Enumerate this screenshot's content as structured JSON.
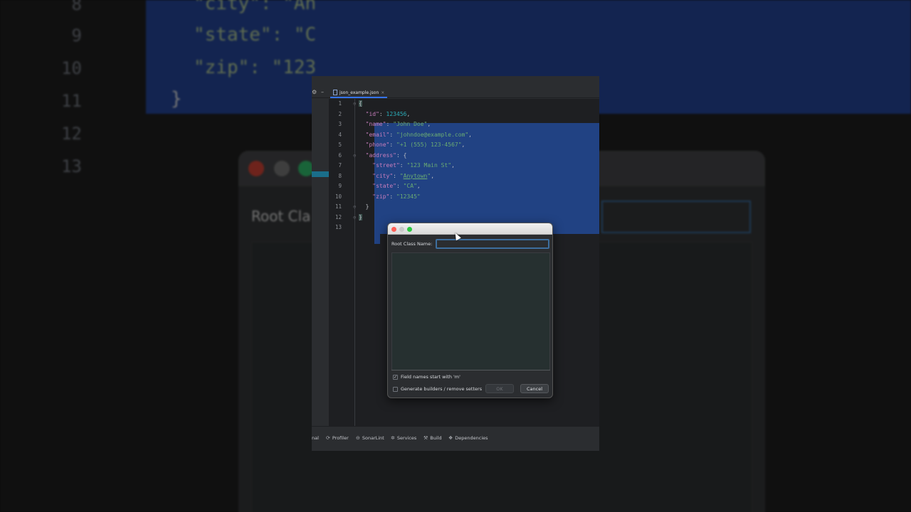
{
  "background": {
    "gutter_numbers": [
      "8",
      "9",
      "10",
      "11",
      "12",
      "13"
    ],
    "code_lines": [
      "\"city\": \"An",
      "\"state\": \"C",
      "\"zip\": \"123",
      "}"
    ],
    "dialog_title": "Root Cla"
  },
  "ide": {
    "tab": {
      "label": "json_example.json",
      "close": "×"
    },
    "toolbar_icons": {
      "settings": "⚙",
      "minimize": "–"
    },
    "lines": [
      {
        "n": "1"
      },
      {
        "n": "2"
      },
      {
        "n": "3"
      },
      {
        "n": "4"
      },
      {
        "n": "5"
      },
      {
        "n": "6"
      },
      {
        "n": "7"
      },
      {
        "n": "8"
      },
      {
        "n": "9"
      },
      {
        "n": "10"
      },
      {
        "n": "11"
      },
      {
        "n": "12"
      },
      {
        "n": "13"
      }
    ],
    "code": {
      "l1": "{",
      "id_key": "\"id\"",
      "id_val": "123456",
      "name_key": "\"name\"",
      "name_val": "\"John Doe\"",
      "email_key": "\"email\"",
      "email_val": "\"johndoe@example.com\"",
      "phone_key": "\"phone\"",
      "phone_val": "\"+1 (555) 123-4567\"",
      "address_key": "\"address\"",
      "street_key": "\"street\"",
      "street_val": "\"123 Main St\"",
      "city_key": "\"city\"",
      "city_q1": "\"",
      "city_val": "Anytown",
      "city_q2": "\"",
      "state_key": "\"state\"",
      "state_val": "\"CA\"",
      "zip_key": "\"zip\"",
      "zip_val": "\"12345\"",
      "close_inner": "}",
      "close_outer": "}"
    },
    "bottom_bar": [
      {
        "icon": "",
        "label": "nal"
      },
      {
        "icon": "⟳",
        "label": "Profiler"
      },
      {
        "icon": "⊖",
        "label": "SonarLint"
      },
      {
        "icon": "✲",
        "label": "Services"
      },
      {
        "icon": "⚒",
        "label": "Build"
      },
      {
        "icon": "❖",
        "label": "Dependencies"
      }
    ]
  },
  "dialog": {
    "root_class_label": "Root Class Name:",
    "root_class_value": "",
    "checkbox_m": {
      "label": "Field names start with 'm'",
      "checked": true,
      "mark": "✓"
    },
    "checkbox_builders": {
      "label": "Generate builders / remove setters",
      "checked": false,
      "mark": ""
    },
    "ok_label": "OK",
    "cancel_label": "Cancel"
  },
  "colors": {
    "selection": "#214283",
    "editor_bg": "#1e1f22",
    "key": "#c77dbb",
    "string": "#6aab73",
    "number": "#2aacb8",
    "accent": "#3574f0"
  }
}
